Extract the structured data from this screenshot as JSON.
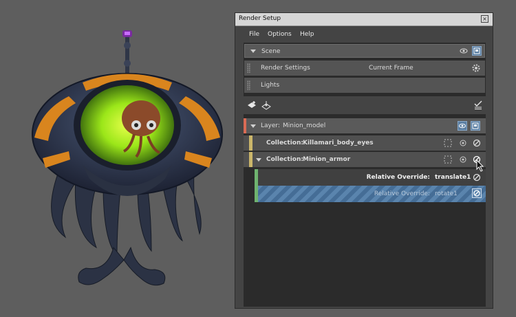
{
  "window": {
    "title": "Render Setup",
    "close_icon": "close-icon"
  },
  "menu": {
    "file": "File",
    "options": "Options",
    "help": "Help"
  },
  "scene": {
    "label": "Scene"
  },
  "render_settings": {
    "label": "Render Settings",
    "value": "Current Frame"
  },
  "lights": {
    "label": "Lights"
  },
  "layer": {
    "prefix": "Layer:",
    "name": "Minion_model"
  },
  "collections": [
    {
      "prefix": "Collection:",
      "name": "Killamari_body_eyes"
    },
    {
      "prefix": "Collection:",
      "name": "Minion_armor"
    }
  ],
  "overrides": [
    {
      "prefix": "Relative Override:",
      "name": "translate1"
    },
    {
      "prefix": "Relative Override:",
      "name": "rotate1"
    }
  ],
  "colors": {
    "layer_stripe": "#d96b55",
    "collection_stripe": "#cbb66a",
    "override_stripe": "#6fb36f",
    "selection": "#456d96"
  }
}
